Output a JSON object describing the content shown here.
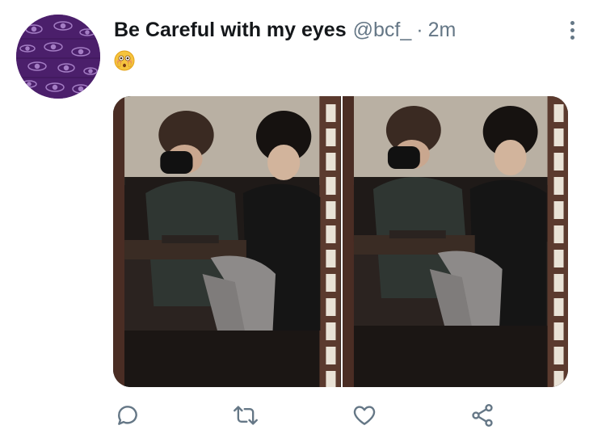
{
  "tweet": {
    "display_name": "Be Careful with my eyes",
    "handle": "@bcf_",
    "separator": "·",
    "time": "2m",
    "text_emoji": "flushed-face-emoji"
  },
  "media": {
    "count": 2,
    "photos": [
      {
        "description_icon": "photo"
      },
      {
        "description_icon": "photo"
      }
    ]
  },
  "actions": [
    {
      "name": "reply",
      "icon": "speech-bubble-icon"
    },
    {
      "name": "retweet",
      "icon": "retweet-arrows-icon"
    },
    {
      "name": "like",
      "icon": "heart-outline-icon"
    },
    {
      "name": "share",
      "icon": "share-nodes-icon"
    }
  ],
  "colors": {
    "text_primary": "#14171a",
    "text_secondary": "#657786",
    "avatar_purple": "#5a2a7a"
  }
}
